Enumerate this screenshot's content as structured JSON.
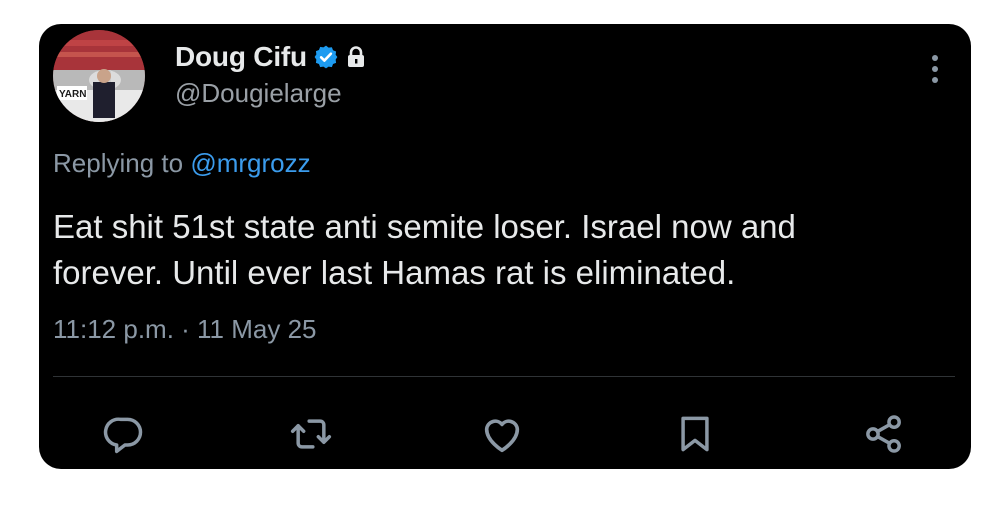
{
  "tweet": {
    "display_name": "Doug Cifu",
    "handle": "@Dougielarge",
    "replying_prefix": "Replying to",
    "replying_to": "@mrgrozz",
    "text": "Eat shit 51st state anti semite loser.  Israel now and\nforever.  Until ever last Hamas rat is eliminated.",
    "timestamp": "11:12 p.m. · 11 May 25",
    "avatar_text": "YARN"
  },
  "icons": {
    "verified": "verified-badge-icon",
    "protected": "lock-icon",
    "more": "more-options-icon",
    "reply": "reply-icon",
    "retweet": "retweet-icon",
    "like": "heart-icon",
    "bookmark": "bookmark-icon",
    "share": "share-icon"
  },
  "colors": {
    "background": "#000000",
    "primary_text": "#e7e9ea",
    "secondary_text": "#8b98a5",
    "mention": "#3b9ced",
    "verified": "#1d9bf0",
    "icon": "#8b98a5",
    "divider": "#2f3336"
  }
}
